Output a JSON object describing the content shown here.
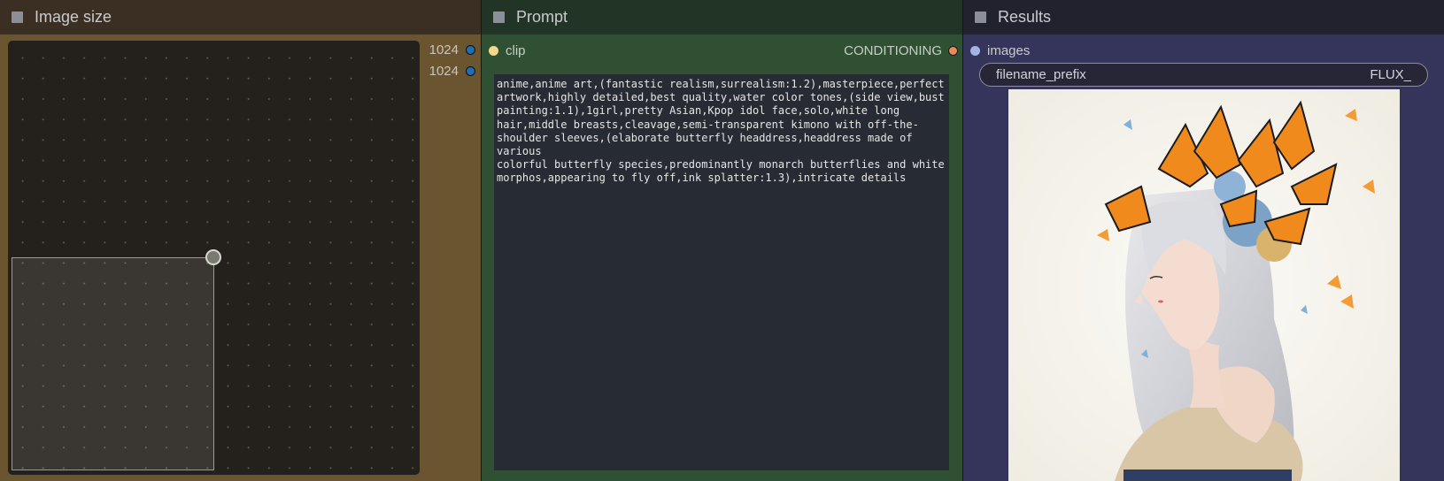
{
  "size_node": {
    "title": "Image size",
    "width_output": "1024",
    "height_output": "1024"
  },
  "prompt_node": {
    "title": "Prompt",
    "input_label": "clip",
    "output_label": "CONDITIONING",
    "text": "anime,anime art,(fantastic realism,surrealism:1.2),masterpiece,perfect\nartwork,highly detailed,best quality,water color tones,(side view,bust\npainting:1.1),1girl,pretty Asian,Kpop idol face,solo,white long\nhair,middle breasts,cleavage,semi-transparent kimono with off-the-\nshoulder sleeves,(elaborate butterfly headdress,headdress made of various\ncolorful butterfly species,predominantly monarch butterflies and white\nmorphos,appearing to fly off,ink splatter:1.3),intricate details"
  },
  "results_node": {
    "title": "Results",
    "input_label": "images",
    "filename_prefix_label": "filename_prefix",
    "filename_prefix_value": "FLUX_"
  },
  "colors": {
    "size_body": "#6b5531",
    "prompt_body": "#2f5032",
    "results_body": "#35345a"
  }
}
